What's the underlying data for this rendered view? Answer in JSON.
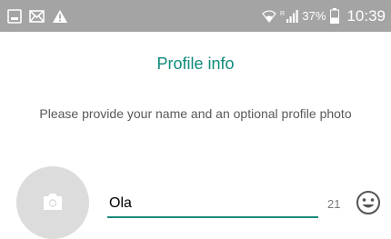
{
  "status_bar": {
    "battery_percent": "37%",
    "time": "10:39",
    "left_icons": [
      "screenshot-icon",
      "mail-icon",
      "warning-icon"
    ],
    "right_icons": [
      "wifi-icon",
      "signal-icon",
      "battery-icon"
    ]
  },
  "header": {
    "title": "Profile info"
  },
  "body": {
    "description": "Please provide your name and an optional profile photo"
  },
  "form": {
    "name_value": "Ola",
    "char_counter": "21",
    "photo_icon": "camera-icon",
    "emoji_icon": "emoji-icon"
  },
  "colors": {
    "accent": "#0f8a7b",
    "status_bar": "#a4a4a4",
    "avatar_bg": "#dcdcdc"
  }
}
